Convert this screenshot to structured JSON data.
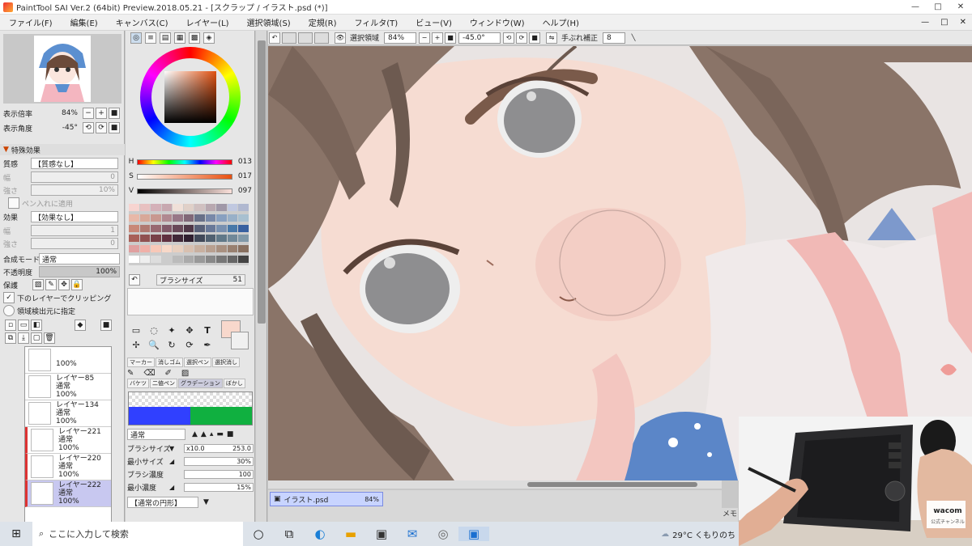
{
  "window": {
    "title": "PaintTool SAI Ver.2 (64bit) Preview.2018.05.21 - [スクラップ / イラスト.psd (*)]",
    "minimize": "—",
    "maximize": "□",
    "close": "✕"
  },
  "menu": [
    "ファイル(F)",
    "編集(E)",
    "キャンバス(C)",
    "レイヤー(L)",
    "選択領域(S)",
    "定規(R)",
    "フィルタ(T)",
    "ビュー(V)",
    "ウィンドウ(W)",
    "ヘルプ(H)"
  ],
  "navigator": {
    "zoom_label": "表示倍率",
    "zoom_value": "84%",
    "angle_label": "表示角度",
    "angle_value": "-45°"
  },
  "effects": {
    "header": "特殊効果",
    "texture_label": "質感",
    "texture_value": "【質感なし】",
    "scale_label": "幅",
    "scale_value": "0",
    "strength_label": "強さ",
    "strength_value": "10%",
    "apply_checkbox": "ペン入れに適用",
    "effect_label": "効果",
    "effect_value": "【効果なし】",
    "width_label": "幅",
    "width_value": "1",
    "effect_strength_label": "強さ",
    "effect_strength_value": "0"
  },
  "layer_props": {
    "blend_label": "合成モード",
    "blend_value": "通常",
    "opacity_label": "不透明度",
    "opacity_value": "100%",
    "protect_label": "保護",
    "clip_checkbox": "下のレイヤーでクリッピング",
    "select_source": "領域検出元に指定"
  },
  "layers": [
    {
      "name": "",
      "mode": "",
      "opacity": "100%",
      "selected": false,
      "red": false
    },
    {
      "name": "レイヤー85",
      "mode": "通常",
      "opacity": "100%",
      "selected": false,
      "red": false
    },
    {
      "name": "レイヤー134",
      "mode": "通常",
      "opacity": "100%",
      "selected": false,
      "red": false
    },
    {
      "name": "レイヤー221",
      "mode": "通常",
      "opacity": "100%",
      "selected": false,
      "red": true
    },
    {
      "name": "レイヤー220",
      "mode": "通常",
      "opacity": "100%",
      "selected": false,
      "red": true
    },
    {
      "name": "レイヤー222",
      "mode": "通常",
      "opacity": "100%",
      "selected": true,
      "red": true
    }
  ],
  "color": {
    "h_label": "H",
    "h_value": "013",
    "s_label": "S",
    "s_value": "017",
    "v_label": "V",
    "v_value": "097",
    "swatches": [
      "#f7d4d0",
      "#e8c0c0",
      "#d4b0b8",
      "#c8a8b0",
      "#f0e0d8",
      "#e0d0c8",
      "#d0c0c0",
      "#b8a8b0",
      "#a098a8",
      "#c0c8e0",
      "#b0b8d0",
      "#e8b8a8",
      "#d8a898",
      "#c89890",
      "#b08890",
      "#987888",
      "#806878",
      "#687088",
      "#7888a8",
      "#88a0c0",
      "#98b0c8",
      "#a8c0d0",
      "#c88878",
      "#b07870",
      "#986870",
      "#805868",
      "#684858",
      "#503848",
      "#586078",
      "#687898",
      "#7890b0",
      "#4878a8",
      "#3860a0",
      "#a86058",
      "#905050",
      "#784048",
      "#603040",
      "#402838",
      "#302030",
      "#404858",
      "#506070",
      "#607888",
      "#708898",
      "#8098a8",
      "#e0a0a0",
      "#f0b0a8",
      "#f8c8b8",
      "#f8d8c8",
      "#e8d0c0",
      "#d8c0b0",
      "#c8b0a0",
      "#b8a090",
      "#a89080",
      "#988070",
      "#887060",
      "#ffffff",
      "#eeeeee",
      "#dddddd",
      "#cccccc",
      "#bbbbbb",
      "#aaaaaa",
      "#999999",
      "#888888",
      "#777777",
      "#666666",
      "#444444"
    ]
  },
  "brush_size_top": {
    "label": "ブラシサイズ",
    "value": "51"
  },
  "tool_tabs_1": [
    "マーカー",
    "消しゴム",
    "選択ペン",
    "選択消し"
  ],
  "tool_tabs_2": [
    "バケツ",
    "二値ペン",
    "グラデーション",
    "ぼかし"
  ],
  "brush": {
    "mode_value": "通常",
    "size_label": "ブラシサイズ",
    "size_mult": "x10.0",
    "size_value": "253.0",
    "min_size_label": "最小サイズ",
    "min_size_value": "30%",
    "density_label": "ブラシ濃度",
    "density_value": "100",
    "min_density_label": "最小濃度",
    "min_density_value": "15%",
    "shape_value": "【通常の円形】"
  },
  "canvas_toolbar": {
    "select_label": "選択領域",
    "zoom_value": "84%",
    "angle_value": "-45.0°",
    "stab_label": "手ぶれ補正",
    "stab_value": "8"
  },
  "doc_tab": {
    "name": "イラスト.psd",
    "zoom": "84%"
  },
  "memory_label": "メモリ",
  "taskbar": {
    "search_placeholder": "ここに入力して検索",
    "weather": "29°C くもりのち"
  },
  "cam_brand": "wacom",
  "cam_sub": "公式チャンネル"
}
